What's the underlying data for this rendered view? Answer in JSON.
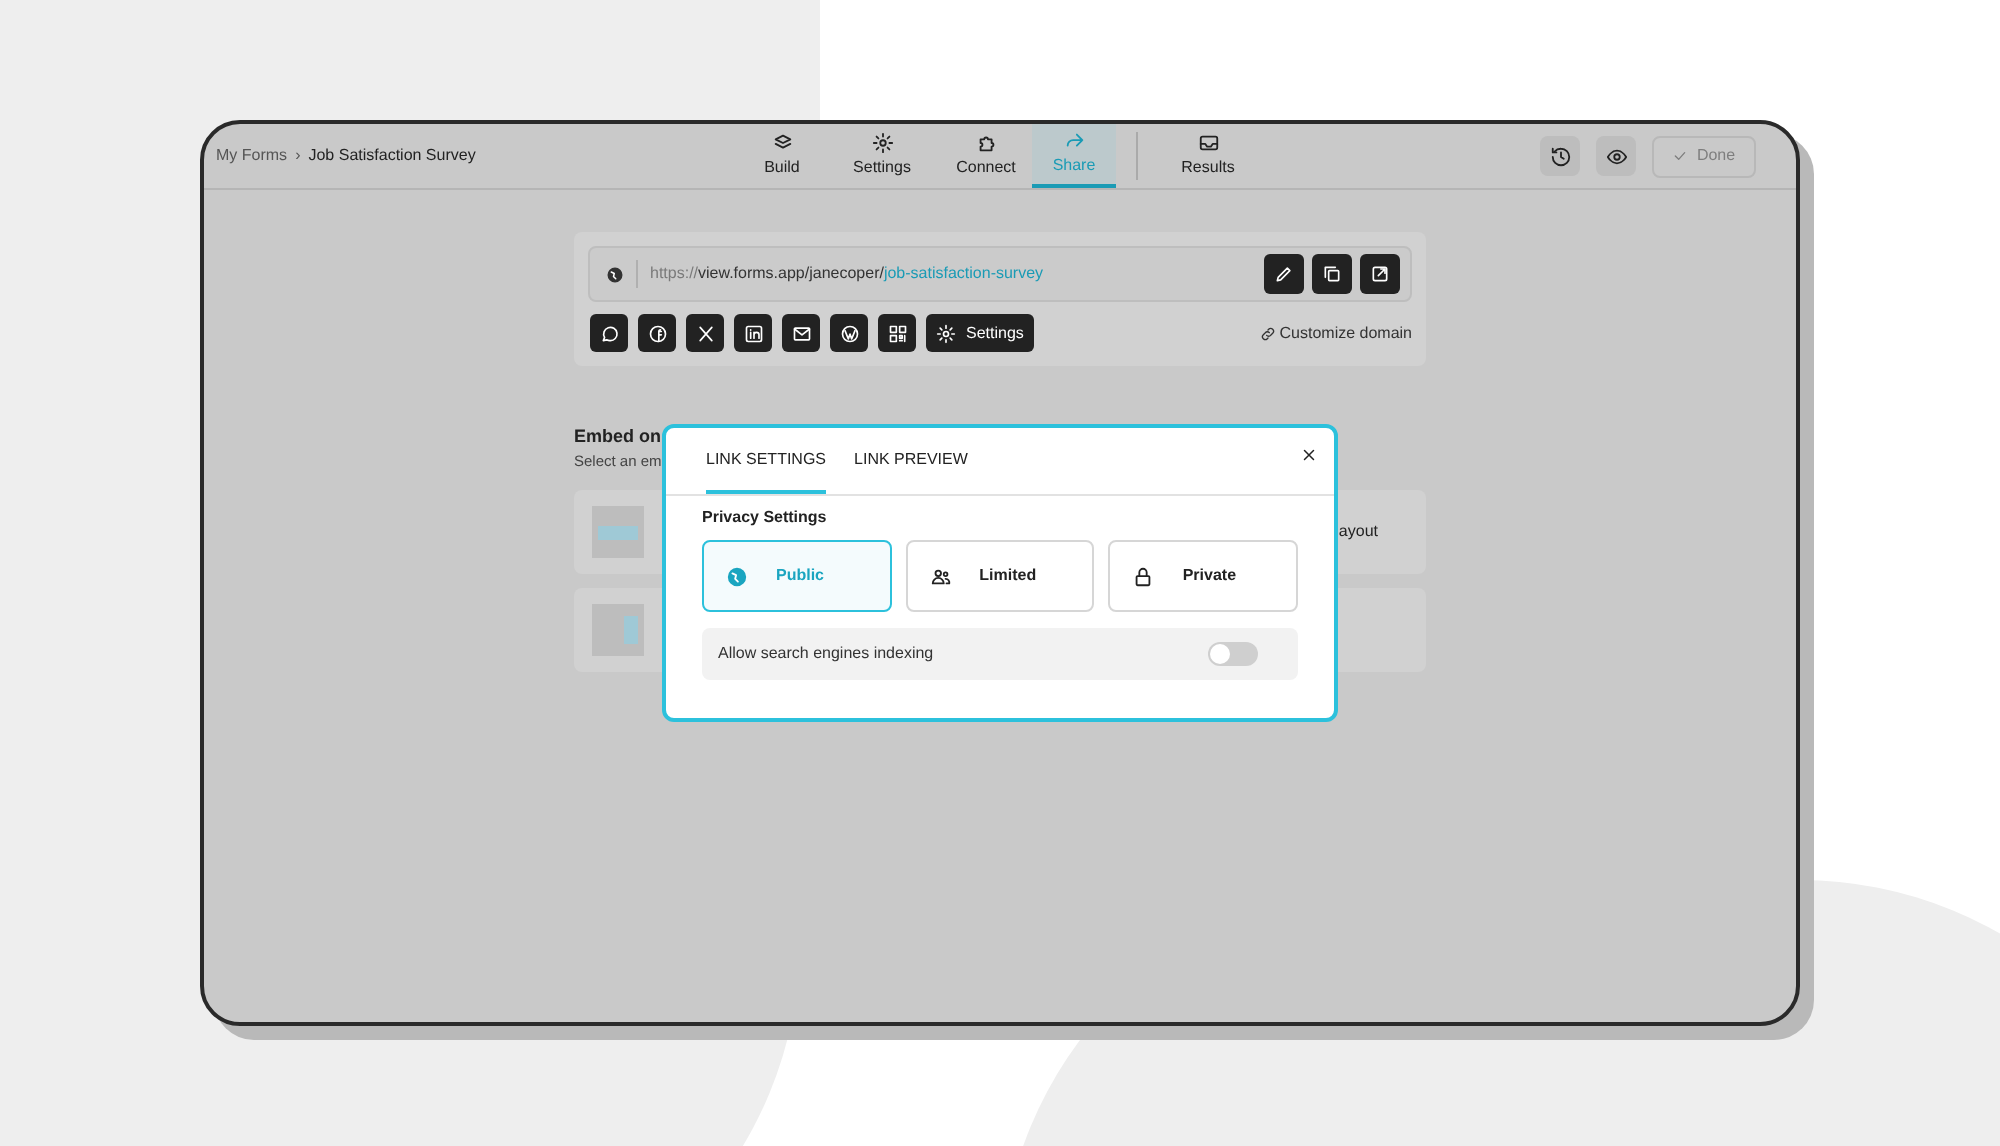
{
  "breadcrumb": {
    "items": [
      "My Forms",
      "Job Satisfaction Survey"
    ],
    "separator": "›"
  },
  "nav_tabs": [
    {
      "label": "Build",
      "selected": false
    },
    {
      "label": "Settings",
      "selected": false
    },
    {
      "label": "Connect",
      "selected": false
    },
    {
      "label": "Share",
      "selected": true
    },
    {
      "label": "Results",
      "selected": false
    }
  ],
  "done_button": {
    "label": "Done",
    "disabled": true
  },
  "share_link": {
    "scheme": "https://",
    "path": "view.forms.app/janecoper/",
    "slug": "job-satisfaction-survey"
  },
  "settings_button": {
    "label": "Settings"
  },
  "customize_domain": "Customize domain",
  "embed": {
    "title": "Embed on",
    "subtitle": "Select an em",
    "card_text": "ayout"
  },
  "modal": {
    "tabs": [
      {
        "label": "LINK SETTINGS",
        "selected": true
      },
      {
        "label": "LINK PREVIEW",
        "selected": false
      }
    ],
    "section_title": "Privacy Settings",
    "options": [
      {
        "label": "Public",
        "selected": true
      },
      {
        "label": "Limited",
        "selected": false
      },
      {
        "label": "Private",
        "selected": false
      }
    ],
    "toggle": {
      "label": "Allow search engines indexing",
      "on": false
    }
  }
}
